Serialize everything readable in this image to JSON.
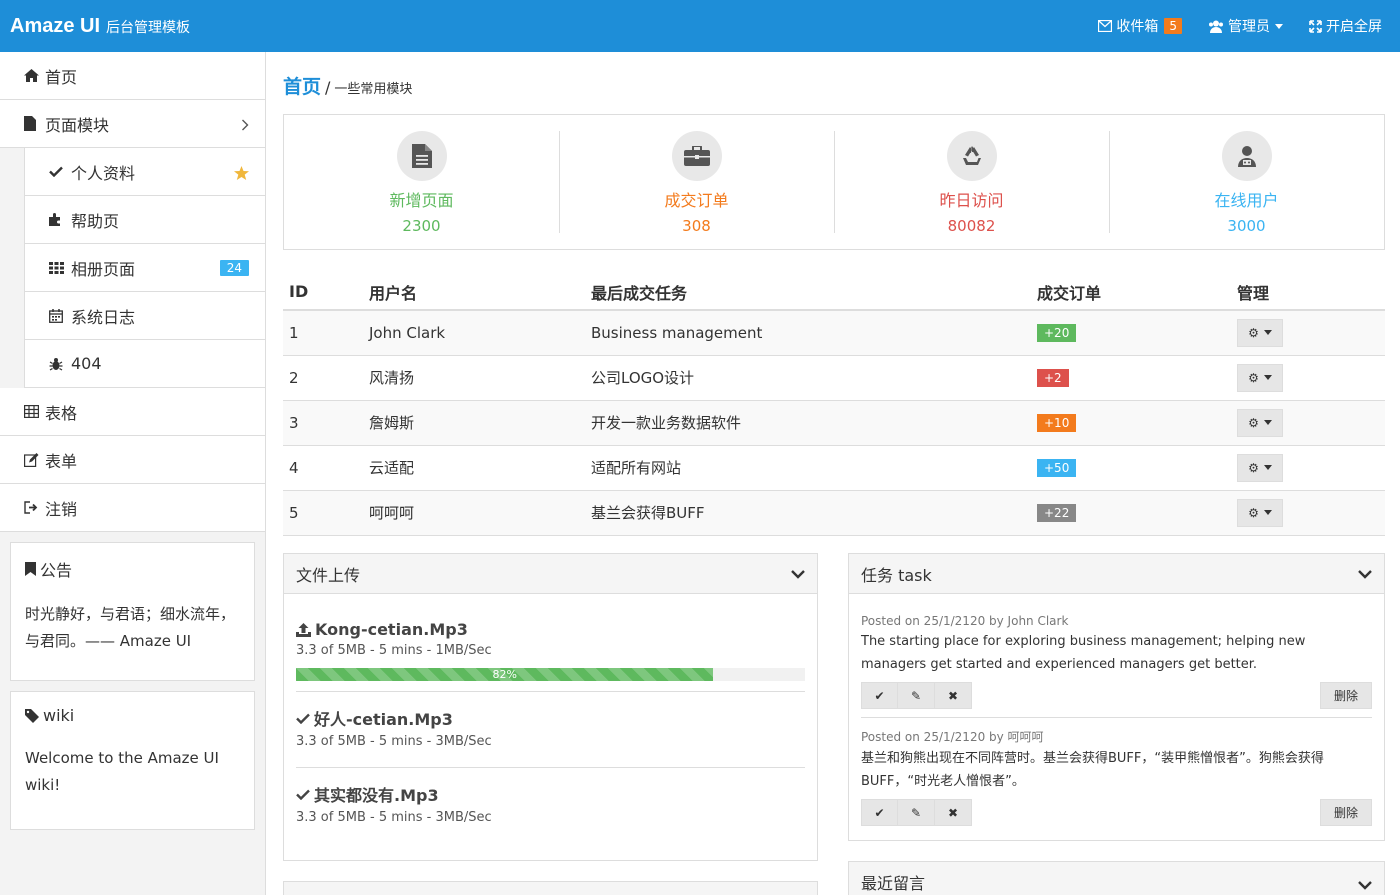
{
  "header": {
    "brand_main": "Amaze UI",
    "brand_sub": "后台管理模板",
    "inbox_label": "收件箱",
    "inbox_count": "5",
    "admin_label": "管理员",
    "fullscreen_label": "开启全屏"
  },
  "sidebar": {
    "home": "首页",
    "pages": "页面模块",
    "sub": {
      "profile": "个人资料",
      "help": "帮助页",
      "gallery": "相册页面",
      "gallery_badge": "24",
      "log": "系统日志",
      "notfound": "404"
    },
    "table": "表格",
    "form": "表单",
    "logout": "注销",
    "notice_title": "公告",
    "notice_body": "时光静好，与君语；细水流年，与君同。—— Amaze UI",
    "wiki_title": "wiki",
    "wiki_body": "Welcome to the Amaze UI wiki!"
  },
  "breadcrumb": {
    "home": "首页",
    "separator": "/",
    "sub": "一些常用模块"
  },
  "stats": [
    {
      "label": "新增页面",
      "value": "2300",
      "color": "#5eb95e",
      "icon": "file-icon"
    },
    {
      "label": "成交订单",
      "value": "308",
      "color": "#F37B1D",
      "icon": "briefcase-icon"
    },
    {
      "label": "昨日访问",
      "value": "80082",
      "color": "#dd514c",
      "icon": "recycle-icon"
    },
    {
      "label": "在线用户",
      "value": "3000",
      "color": "#3bb4f2",
      "icon": "users-icon"
    }
  ],
  "table": {
    "headers": [
      "ID",
      "用户名",
      "最后成交任务",
      "成交订单",
      "管理"
    ],
    "rows": [
      {
        "id": "1",
        "user": "John Clark",
        "task": "Business management",
        "orders": "+20",
        "color": "#5eb95e"
      },
      {
        "id": "2",
        "user": "风清扬",
        "task": "公司LOGO设计",
        "orders": "+2",
        "color": "#dd514c"
      },
      {
        "id": "3",
        "user": "詹姆斯",
        "task": "开发一款业务数据软件",
        "orders": "+10",
        "color": "#F37B1D"
      },
      {
        "id": "4",
        "user": "云适配",
        "task": "适配所有网站",
        "orders": "+50",
        "color": "#3bb4f2"
      },
      {
        "id": "5",
        "user": "呵呵呵",
        "task": "基兰会获得BUFF",
        "orders": "+22",
        "color": "#888888"
      }
    ]
  },
  "upload_panel": {
    "title": "文件上传",
    "files": [
      {
        "name": "Kong-cetian.Mp3",
        "meta": "3.3 of 5MB - 5 mins - 1MB/Sec",
        "progress_text": "82%",
        "progress": 0.82
      },
      {
        "name": "好人-cetian.Mp3",
        "meta": "3.3 of 5MB - 5 mins - 3MB/Sec"
      },
      {
        "name": "其实都没有.Mp3",
        "meta": "3.3 of 5MB - 5 mins - 3MB/Sec"
      }
    ]
  },
  "task_panel": {
    "title": "任务 task",
    "delete_label": "删除",
    "tasks": [
      {
        "meta": "Posted on 25/1/2120 by John Clark",
        "text": "The starting place for exploring business management; helping new managers get started and experienced managers get better."
      },
      {
        "meta": "Posted on 25/1/2120 by 呵呵呵",
        "text": "基兰和狗熊出现在不同阵营时。基兰会获得BUFF，“装甲熊憎恨者”。狗熊会获得BUFF，“时光老人憎恨者”。"
      }
    ]
  },
  "comments_panel": {
    "title": "最近留言"
  }
}
